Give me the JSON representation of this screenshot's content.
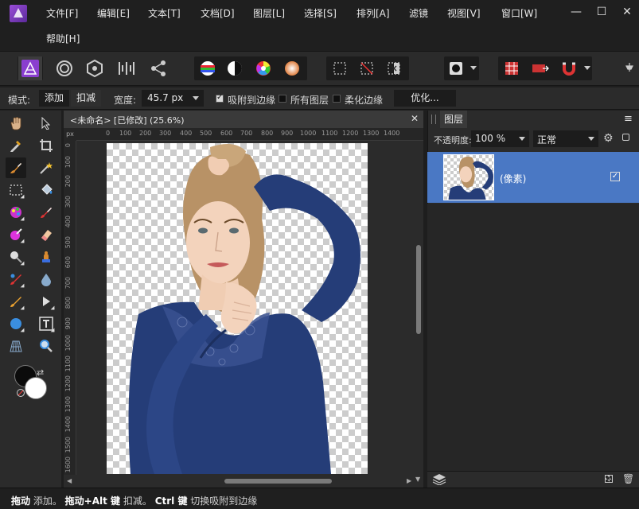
{
  "menu": {
    "items": [
      "文件[F]",
      "编辑[E]",
      "文本[T]",
      "文档[D]",
      "图层[L]",
      "选择[S]",
      "排列[A]",
      "滤镜",
      "视图[V]",
      "窗口[W]"
    ],
    "help": "帮助[H]",
    "window_controls": {
      "minimize": "—",
      "maximize": "☐",
      "close": "✕"
    }
  },
  "context_bar": {
    "mode_label": "模式:",
    "mode_add": "添加",
    "mode_subtract": "扣减",
    "width_label": "宽度:",
    "width_value": "45.7 px",
    "snap_edges": "吸附到边缘",
    "snap_edges_checked": true,
    "all_layers": "所有图层",
    "all_layers_checked": false,
    "soften_edges": "柔化边缘",
    "soften_edges_checked": false,
    "refine_button": "优化..."
  },
  "document": {
    "tab_title": "<未命名> [已修改] (25.6%)",
    "close": "✕",
    "ruler_unit": "px",
    "ruler_h_ticks": [
      "0",
      "100",
      "200",
      "300",
      "400",
      "500",
      "600",
      "700",
      "800",
      "900",
      "1000",
      "1100",
      "1200",
      "1300",
      "1400"
    ],
    "ruler_v_ticks": [
      "0",
      "100",
      "200",
      "300",
      "400",
      "500",
      "600",
      "700",
      "800",
      "900",
      "1000",
      "1100",
      "1200",
      "1300",
      "1400",
      "1500",
      "1600"
    ]
  },
  "layers_panel": {
    "tab_label": "图层",
    "menu_icon": "≡",
    "opacity_label": "不透明度:",
    "opacity_value": "100 %",
    "blend_mode": "正常",
    "layer_name": "(像素)",
    "layer_visible": true
  },
  "status": {
    "part1_bold": "拖动",
    "part1": " 添加。",
    "part2_bold": "拖动+Alt 键",
    "part2": " 扣减。",
    "part3_bold": "Ctrl 键",
    "part3": " 切换吸附到边缘"
  },
  "colors": {
    "accent_blue": "#4a78c4",
    "app_purple": "#8a3ecf",
    "sweater_blue": "#253d78"
  }
}
